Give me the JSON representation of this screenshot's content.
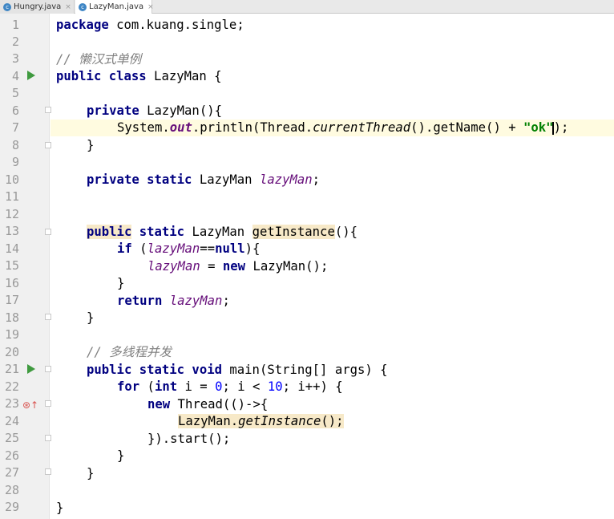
{
  "tabs": [
    {
      "label": "Hungry.java",
      "close": "×"
    },
    {
      "label": "LazyMan.java",
      "close": "×"
    }
  ],
  "editor": {
    "line_numbers": [
      "1",
      "2",
      "3",
      "4",
      "5",
      "6",
      "7",
      "8",
      "9",
      "10",
      "11",
      "12",
      "13",
      "14",
      "15",
      "16",
      "17",
      "18",
      "19",
      "20",
      "21",
      "22",
      "23",
      "24",
      "25",
      "26",
      "27",
      "28",
      "29"
    ],
    "lines": {
      "l1_a": "package",
      "l1_b": " com.kuang.single;",
      "l3": "// 懒汉式单例",
      "l4_a": "public class",
      "l4_b": " LazyMan {",
      "l6_a": "private",
      "l6_b": " LazyMan(){",
      "l7_a": "System.",
      "l7_b": "out",
      "l7_c": ".println(Thread.",
      "l7_d": "currentThread",
      "l7_e": "().getName() + ",
      "l7_f": "\"ok\"",
      "l7_g": ");",
      "l8": "}",
      "l10_a": "private static",
      "l10_b": " LazyMan ",
      "l10_c": "lazyMan",
      "l10_d": ";",
      "l13_a": "public",
      "l13_b": " static",
      "l13_c": " LazyMan ",
      "l13_d": "getInstance",
      "l13_e": "(){",
      "l14_a": "if",
      "l14_b": " (",
      "l14_c": "lazyMan",
      "l14_d": "==",
      "l14_e": "null",
      "l14_f": "){",
      "l15_a": "lazyMan",
      "l15_b": " = ",
      "l15_c": "new",
      "l15_d": " LazyMan();",
      "l16": "}",
      "l17_a": "return",
      "l17_b": " lazyMan",
      "l17_c": ";",
      "l18": "}",
      "l20": "// 多线程并发",
      "l21_a": "public static void",
      "l21_b": " main(String[] args) {",
      "l22_a": "for",
      "l22_b": " (",
      "l22_c": "int",
      "l22_d": " i = ",
      "l22_e": "0",
      "l22_f": "; i < ",
      "l22_g": "10",
      "l22_h": "; i++) {",
      "l23_a": "new",
      "l23_b": " Thread(()->{",
      "l24_a": "LazyMan.",
      "l24_b": "getInstance",
      "l24_c": "();",
      "l25": "}).start();",
      "l26": "}",
      "l27": "}",
      "l29": "}"
    }
  }
}
